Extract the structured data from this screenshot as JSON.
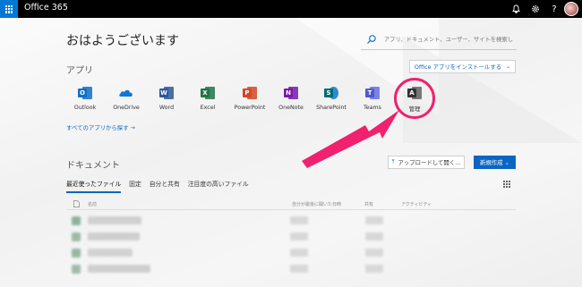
{
  "header": {
    "brand": "Office 365",
    "icons": [
      "app-launcher-icon",
      "bell-icon",
      "gear-icon",
      "help-icon",
      "avatar"
    ]
  },
  "greeting": "おはようございます",
  "search": {
    "placeholder": "アプリ、ドキュメント、ユーザー、サイトを検索し"
  },
  "apps": {
    "heading": "アプリ",
    "install_label": "Office アプリをインストールする",
    "items": [
      {
        "label": "Outlook",
        "letter": "O",
        "color": "#0f6fc6"
      },
      {
        "label": "OneDrive",
        "letter": "",
        "color": "#0f78d4"
      },
      {
        "label": "Word",
        "letter": "W",
        "color": "#2b579a"
      },
      {
        "label": "Excel",
        "letter": "X",
        "color": "#217346"
      },
      {
        "label": "PowerPoint",
        "letter": "P",
        "color": "#d24726"
      },
      {
        "label": "OneNote",
        "letter": "N",
        "color": "#7719aa"
      },
      {
        "label": "SharePoint",
        "letter": "S",
        "color": "#0a78d4"
      },
      {
        "label": "Teams",
        "letter": "T",
        "color": "#5059c9"
      },
      {
        "label": "管理",
        "letter": "A",
        "color": "#444444"
      }
    ],
    "explore_all": "すべてのアプリから探す →"
  },
  "documents": {
    "heading": "ドキュメント",
    "upload_label": "アップロードして開く...",
    "new_label": "新規作成 ⌄",
    "tabs": [
      "最近使ったファイル",
      "固定",
      "自分と共有",
      "注目度の高いファイル"
    ],
    "columns": {
      "name": "名前",
      "last_opened": "自分が最後に開いた日時",
      "shared": "共有",
      "activity": "アクティビティ"
    }
  },
  "colors": {
    "accent": "#0a66c2",
    "highlight": "#f0216f"
  }
}
